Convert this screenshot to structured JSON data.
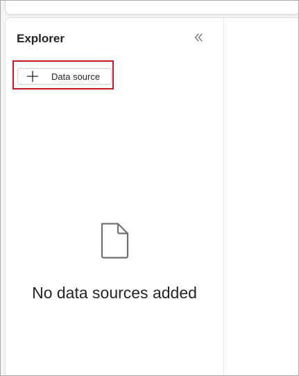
{
  "explorer": {
    "title": "Explorer",
    "collapse_icon": "chevron-double-left-icon",
    "add_button": {
      "icon": "plus-icon",
      "label": "Data source"
    },
    "empty_state": {
      "icon": "document-icon",
      "message": "No data sources added"
    }
  },
  "colors": {
    "highlight": "#c8191e",
    "text": "#242424",
    "background": "#f4f4f4"
  }
}
